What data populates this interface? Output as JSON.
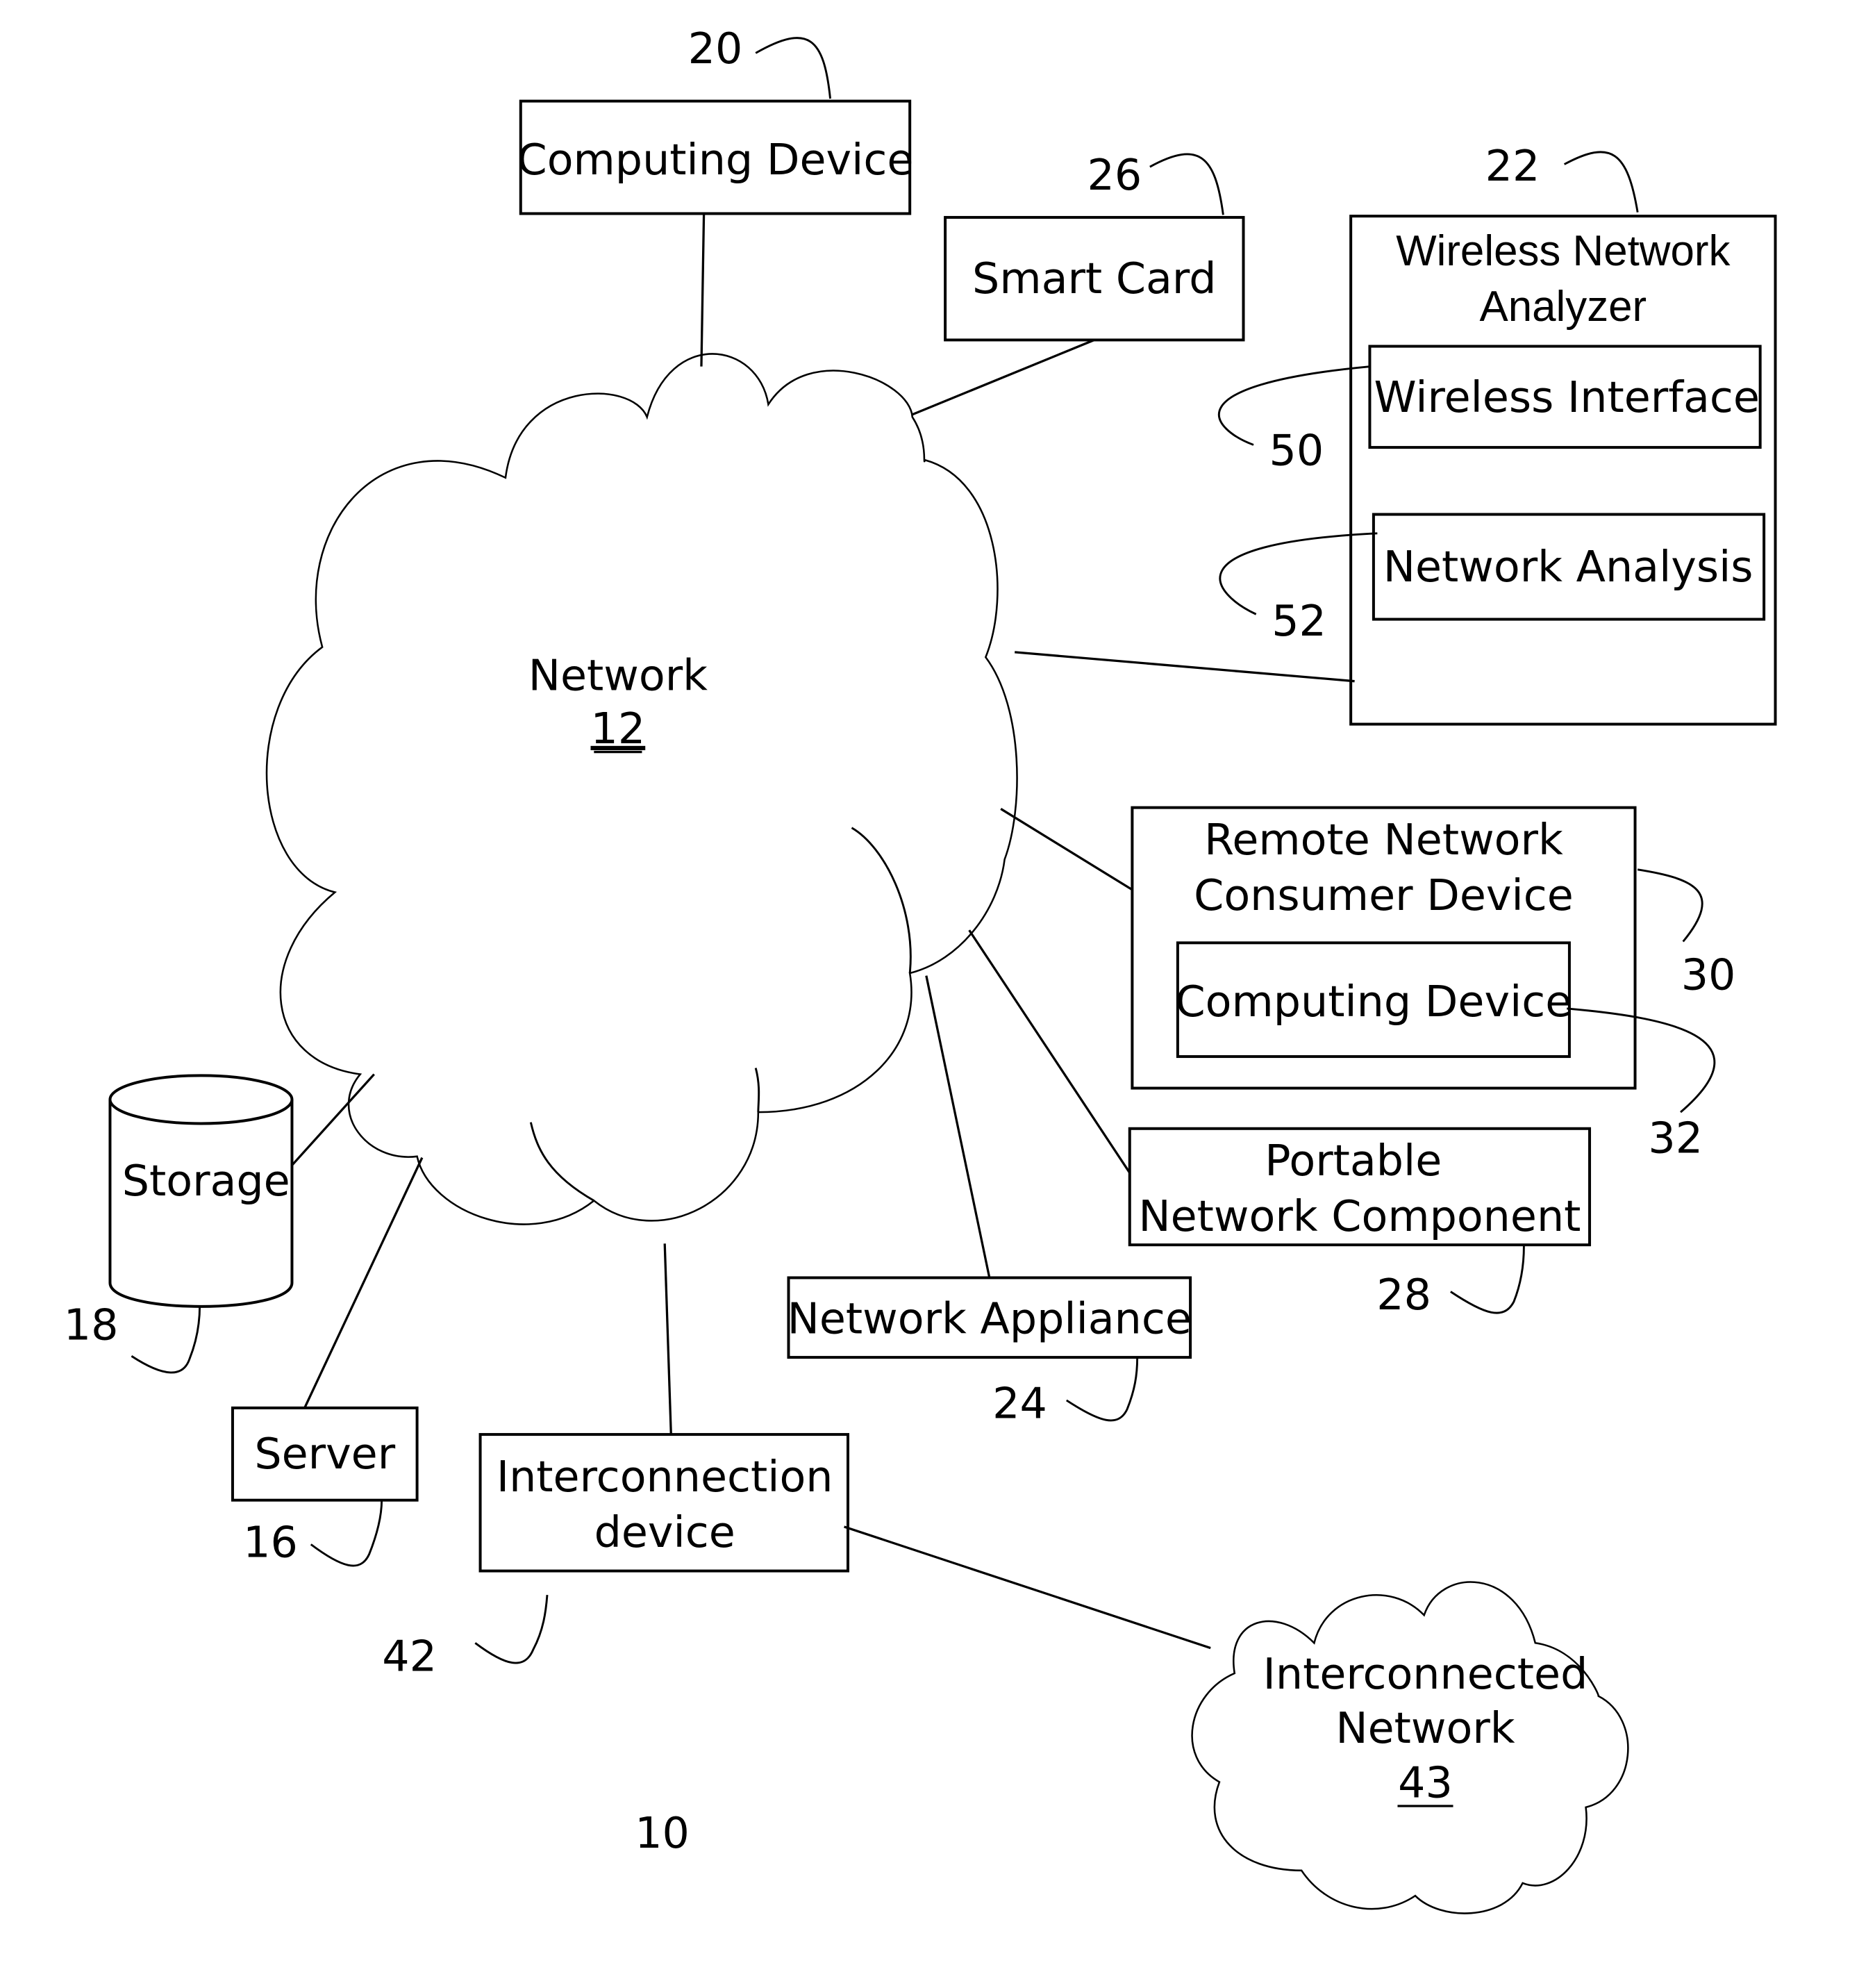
{
  "diagram": {
    "figure_ref": "10",
    "network": {
      "title": "Network",
      "ref": "12"
    },
    "computing_device_top": {
      "label": "Computing Device",
      "ref": "20"
    },
    "smart_card": {
      "label": "Smart Card",
      "ref": "26"
    },
    "wireless_analyzer": {
      "title_line1": "Wireless Network",
      "title_line2": "Analyzer",
      "ref": "22",
      "wireless_interface": {
        "label": "Wireless Interface",
        "ref": "50"
      },
      "network_analysis": {
        "label": "Network Analysis",
        "ref": "52"
      }
    },
    "remote_consumer": {
      "title_line1": "Remote Network",
      "title_line2": "Consumer Device",
      "ref": "30",
      "computing_device": {
        "label": "Computing Device",
        "ref": "32"
      }
    },
    "portable_component": {
      "line1": "Portable",
      "line2": "Network Component",
      "ref": "28"
    },
    "network_appliance": {
      "label": "Network Appliance",
      "ref": "24"
    },
    "storage": {
      "label": "Storage",
      "ref": "18"
    },
    "server": {
      "label": "Server",
      "ref": "16"
    },
    "interconnection_device": {
      "line1": "Interconnection",
      "line2": "device",
      "ref": "42"
    },
    "interconnected_network": {
      "line1": "Interconnected",
      "line2": "Network",
      "ref": "43"
    }
  }
}
